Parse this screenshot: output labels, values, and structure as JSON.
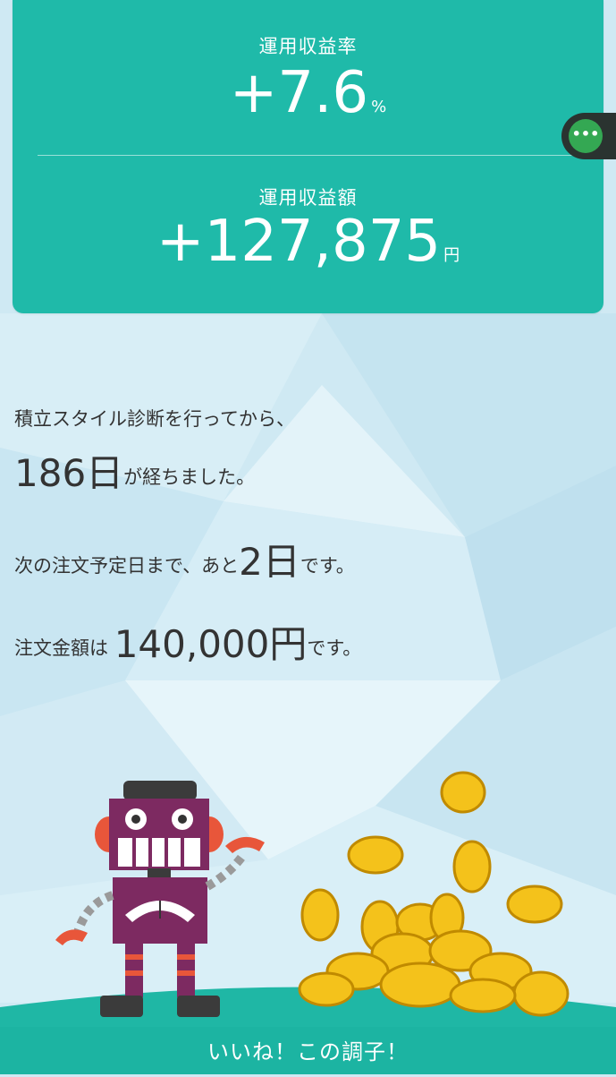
{
  "performance": {
    "rate_label": "運用収益率",
    "rate_value": "+7.6",
    "rate_unit": "%",
    "amount_label": "運用収益額",
    "amount_value": "+127,875",
    "amount_unit": "円"
  },
  "info": {
    "line1": "積立スタイル診断を行ってから、",
    "days_elapsed": "186日",
    "days_elapsed_suffix": "が経ちました。",
    "next_order_prefix": "次の注文予定日まで、あと",
    "next_order_days": "2日",
    "next_order_suffix": "です。",
    "amount_prefix": "注文金額は",
    "amount_value": "140,000円",
    "amount_suffix": "です。"
  },
  "more_button": {
    "icon": "more-horizontal-icon",
    "label": "…"
  },
  "footer": {
    "text": "いいね！この調子！"
  },
  "colors": {
    "accent": "#1fbaa9",
    "background": "#cfe9f3",
    "text": "#333333",
    "more_button": "#34a853"
  }
}
